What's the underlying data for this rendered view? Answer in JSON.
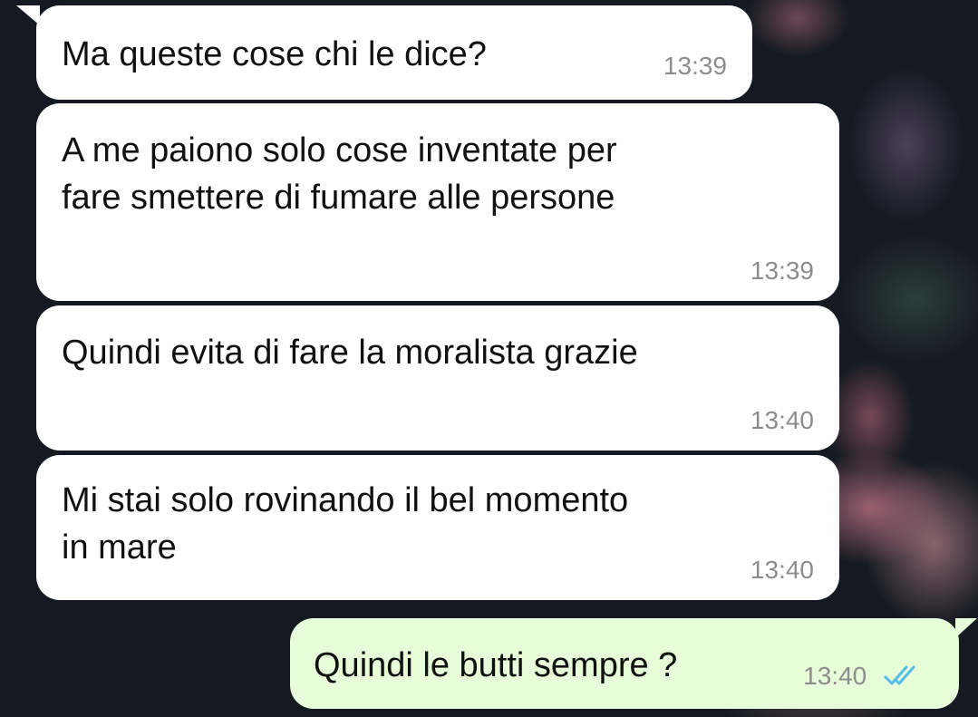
{
  "messages": [
    {
      "direction": "incoming",
      "text": "Ma queste cose chi le dice?",
      "time": "13:39"
    },
    {
      "direction": "incoming",
      "text": "A me paiono solo cose inventate per\nfare smettere di fumare alle persone",
      "time": "13:39"
    },
    {
      "direction": "incoming",
      "text": "Quindi evita di fare la moralista grazie",
      "time": "13:40"
    },
    {
      "direction": "incoming",
      "text": "Mi stai solo rovinando il bel momento\nin mare",
      "time": "13:40"
    },
    {
      "direction": "outgoing",
      "text": "Quindi le butti sempre ?",
      "time": "13:40",
      "status": "read"
    }
  ],
  "colors": {
    "incoming_bubble": "#ffffff",
    "outgoing_bubble": "#e7fcd8",
    "timestamp": "#8c8c8c",
    "read_ticks": "#53bdeb",
    "background": "#151a22"
  },
  "icons": {
    "read_status": "double-check-icon"
  }
}
